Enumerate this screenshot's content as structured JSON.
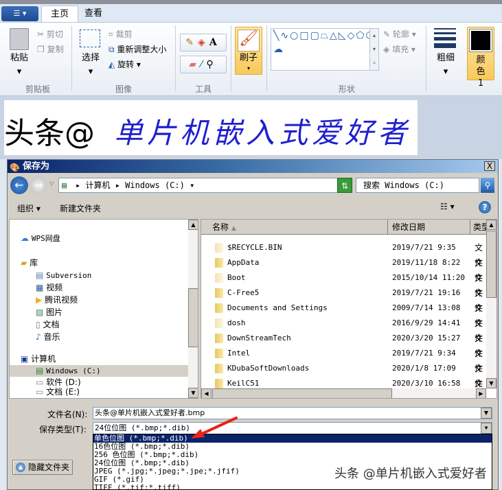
{
  "ribbon": {
    "tabs": [
      "主页",
      "查看"
    ],
    "clipboard": {
      "paste": "粘贴",
      "cut": "剪切",
      "copy": "复制",
      "label": "剪贴板"
    },
    "image": {
      "select": "选择",
      "crop": "裁剪",
      "resize": "重新调整大小",
      "rotate": "旋转",
      "label": "图像"
    },
    "tools": {
      "label": "工具"
    },
    "brush": "刷子",
    "shapes": {
      "outline": "轮廓",
      "fill": "填充",
      "label": "形状",
      "glyphs": "╲∿○□▢⏢△◺◇⬠⬡⇨⇦⇧⇩✧☆✡▭◯☁"
    },
    "size": "粗细",
    "color1": "颜色 1",
    "colors": {
      "accent": "#f8c95b",
      "title": "#0a246a"
    }
  },
  "canvas": {
    "text_black": "头条@",
    "text_blue": "单片机嵌入式爱好者"
  },
  "dialog": {
    "title": "保存为",
    "close": "X",
    "breadcrumb": [
      "计算机",
      "Windows (C:)"
    ],
    "search_placeholder": "搜索 Windows (C:)",
    "toolbar": {
      "organize": "组织",
      "new_folder": "新建文件夹"
    },
    "nav": {
      "wps": "WPS网盘",
      "libraries": "库",
      "lib_items": [
        "Subversion",
        "视频",
        "腾讯视频",
        "图片",
        "文档",
        "音乐"
      ],
      "computer": "计算机",
      "drives": [
        "Windows (C:)",
        "软件 (D:)",
        "文档 (E:)"
      ]
    },
    "columns": [
      "名称",
      "修改日期",
      "类型"
    ],
    "files": [
      {
        "name": "$RECYCLE.BIN",
        "date": "2019/7/21 9:35",
        "type": "文件"
      },
      {
        "name": "AppData",
        "date": "2019/11/18 8:22",
        "type": "文件"
      },
      {
        "name": "Boot",
        "date": "2015/10/14 11:20",
        "type": "文件"
      },
      {
        "name": "C-Free5",
        "date": "2019/7/21 19:16",
        "type": "文件"
      },
      {
        "name": "Documents and Settings",
        "date": "2009/7/14 13:08",
        "type": "文件"
      },
      {
        "name": "dosh",
        "date": "2016/9/29 14:41",
        "type": "文件"
      },
      {
        "name": "DownStreamTech",
        "date": "2020/3/20 15:27",
        "type": "文件"
      },
      {
        "name": "Intel",
        "date": "2019/7/21 9:34",
        "type": "文件"
      },
      {
        "name": "KDubaSoftDownloads",
        "date": "2020/1/8 17:09",
        "type": "文件"
      },
      {
        "name": "KeilC51",
        "date": "2020/3/10 16:58",
        "type": "文件"
      }
    ],
    "filename_label": "文件名(N):",
    "filename": "头条@单片机嵌入式爱好者.bmp",
    "filetype_label": "保存类型(T):",
    "filetype": "24位位图 (*.bmp;*.dib)",
    "filetype_options": [
      "单色位图 (*.bmp;*.dib)",
      "16色位图 (*.bmp;*.dib)",
      "256 色位图 (*.bmp;*.dib)",
      "24位位图 (*.bmp;*.dib)",
      "JPEG (*.jpg;*.jpeg;*.jpe;*.jfif)",
      "GIF (*.gif)",
      "TIFF (*.tif;*.tiff)"
    ],
    "hide_folders": "隐藏文件夹"
  },
  "watermark": "头条 @单片机嵌入式爱好者"
}
